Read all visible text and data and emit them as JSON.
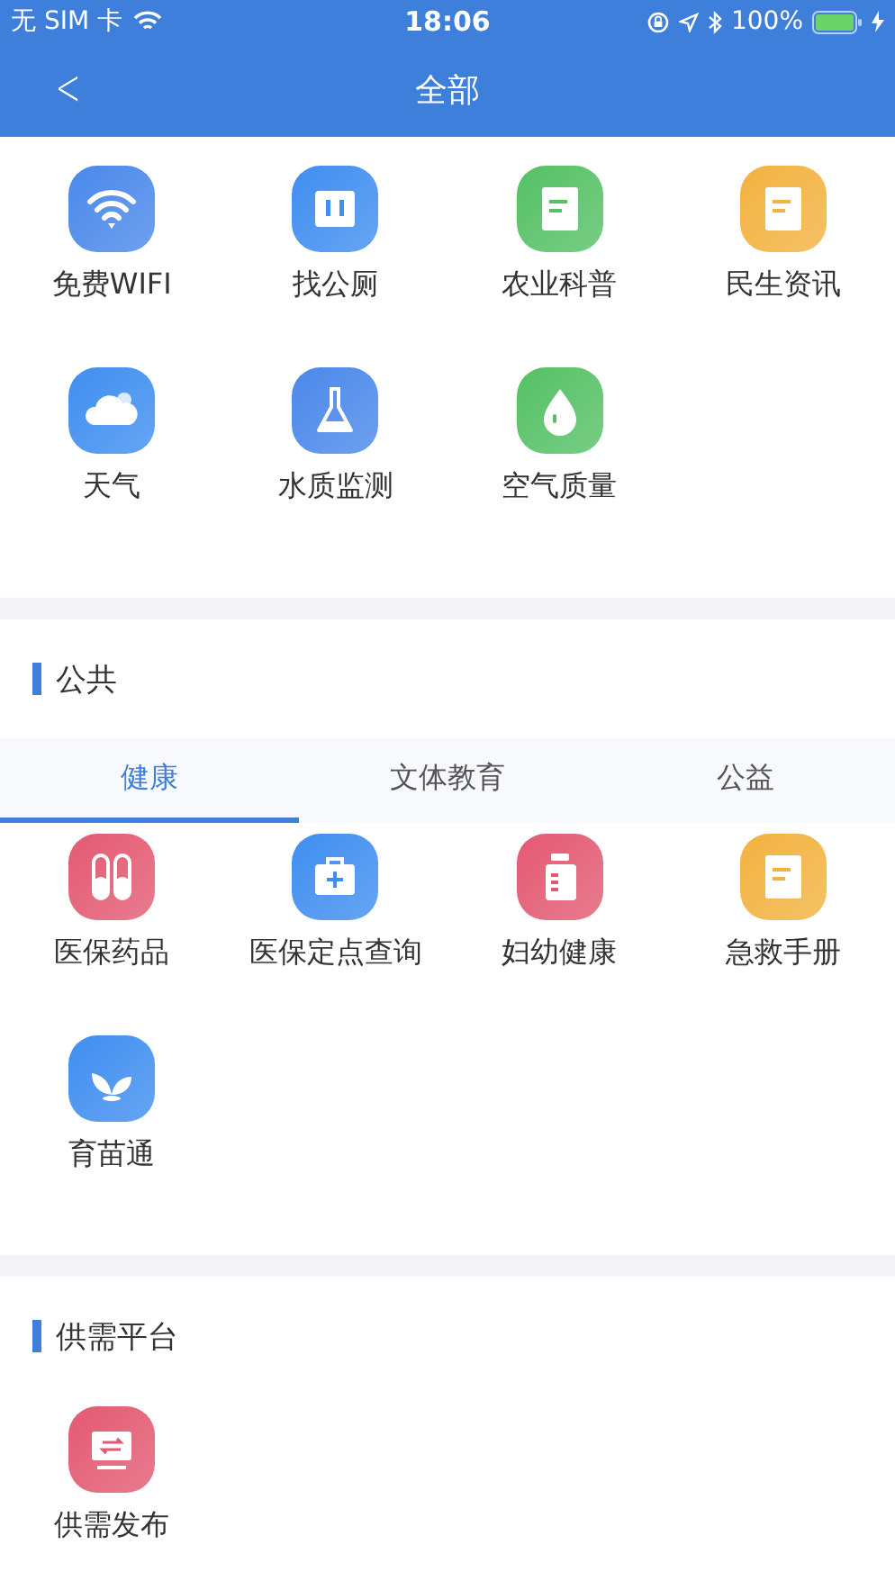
{
  "status_bar": {
    "carrier": "无 SIM 卡",
    "time": "18:06",
    "battery": "100%"
  },
  "nav": {
    "back": "<",
    "title": "全部"
  },
  "top_grid": {
    "items": [
      {
        "label": "免费WIFI",
        "kind": "wifi",
        "color": "#4a88ea"
      },
      {
        "label": "找公厕",
        "kind": "panel",
        "color": "#3f8ef0"
      },
      {
        "label": "农业科普",
        "kind": "document",
        "color": "#55c165"
      },
      {
        "label": "民生资讯",
        "kind": "document",
        "color": "#f2b23f"
      },
      {
        "label": "天气",
        "kind": "cloud",
        "color": "#3f8ef0"
      },
      {
        "label": "水质监测",
        "kind": "flask",
        "color": "#4a88ea"
      },
      {
        "label": "空气质量",
        "kind": "drop",
        "color": "#55c165"
      }
    ]
  },
  "sections": [
    {
      "title": "公共",
      "tabs": [
        {
          "label": "健康",
          "selected": true
        },
        {
          "label": "文体教育",
          "selected": false
        },
        {
          "label": "公益",
          "selected": false
        }
      ],
      "items": [
        {
          "label": "医保药品",
          "kind": "pills",
          "color": "#e35a72"
        },
        {
          "label": "医保定点查询",
          "kind": "medkit",
          "color": "#3f8ef0"
        },
        {
          "label": "妇幼健康",
          "kind": "bottle",
          "color": "#e35a72"
        },
        {
          "label": "急救手册",
          "kind": "document",
          "color": "#f2b23f"
        },
        {
          "label": "育苗通",
          "kind": "leaf",
          "color": "#3f8ef0"
        }
      ]
    },
    {
      "title": "供需平台",
      "items": [
        {
          "label": "供需发布",
          "kind": "monitor",
          "color": "#e35a72"
        }
      ]
    }
  ]
}
